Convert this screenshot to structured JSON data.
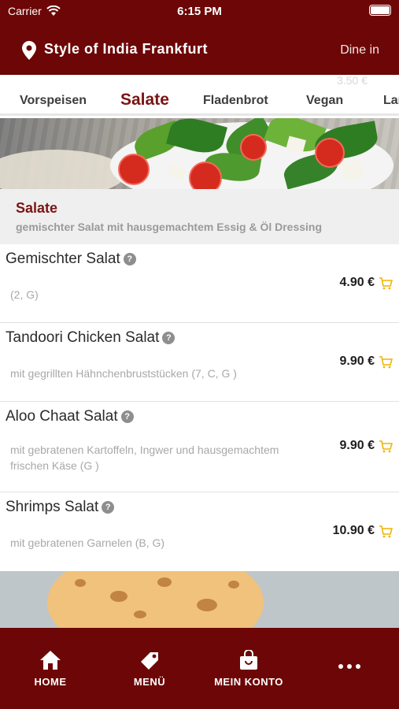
{
  "status_bar": {
    "carrier": "Carrier",
    "time": "6:15 PM"
  },
  "header": {
    "title": "Style of India Frankfurt",
    "mode": "Dine in"
  },
  "tabs": {
    "ghost_price": "3.50 €",
    "items": [
      "Vorspeisen",
      "Salate",
      "Fladenbrot",
      "Vegan",
      "Lar"
    ],
    "active": "Salate"
  },
  "section": {
    "title": "Salate",
    "description": "gemischter Salat mit hausgemachtem Essig & Öl Dressing"
  },
  "menu_items": [
    {
      "name": "Gemischter Salat",
      "desc_line1": "(2, G)",
      "desc_line2": "",
      "price": "4.90 €"
    },
    {
      "name": "Tandoori Chicken Salat",
      "desc_line1": "mit gegrillten Hähnchenbruststücken (7, C, G )",
      "desc_line2": "",
      "price": "9.90 €"
    },
    {
      "name": "Aloo Chaat Salat",
      "desc_line1": "mit gebratenen Kartoffeln, Ingwer und hausgemachtem",
      "desc_line2": "frischen Käse (G )",
      "price": "9.90 €"
    },
    {
      "name": "Shrimps Salat",
      "desc_line1": "mit gebratenen Garnelen (B, G)",
      "desc_line2": "",
      "price": "10.90 €"
    }
  ],
  "tabbar": {
    "home": "HOME",
    "menu": "MENÜ",
    "account": "MEIN KONTO"
  },
  "icons": {
    "location": "location-pin-icon",
    "info": "info-icon",
    "cart": "cart-icon",
    "home": "home-icon",
    "tag": "tag-icon",
    "bag": "shopping-bag-icon",
    "more": "more-icon"
  },
  "colors": {
    "brand": "#6d0606",
    "accent_text": "#7a1414",
    "cart": "#f0b400"
  }
}
